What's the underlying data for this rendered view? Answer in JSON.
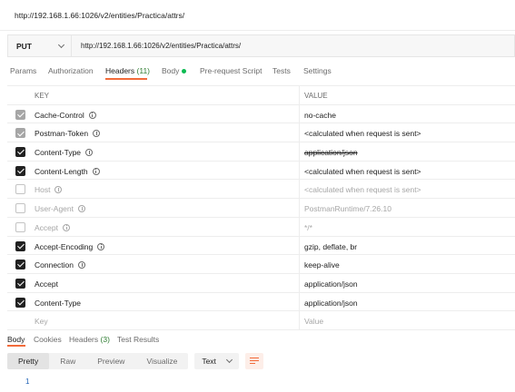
{
  "window": {
    "title_url": "http://192.168.1.66:1026/v2/entities/Practica/attrs/"
  },
  "request": {
    "method": "PUT",
    "url": "http://192.168.1.66:1026/v2/entities/Practica/attrs/"
  },
  "request_tabs": [
    {
      "label": "Params"
    },
    {
      "label": "Authorization"
    },
    {
      "label": "Headers",
      "count": "(11)"
    },
    {
      "label": "Body"
    },
    {
      "label": "Pre-request Script"
    },
    {
      "label": "Tests"
    },
    {
      "label": "Settings"
    }
  ],
  "headers_table": {
    "columns": {
      "key": "KEY",
      "value": "VALUE"
    },
    "rows": [
      {
        "key": "Cache-Control",
        "value": "no-cache",
        "state": "auto"
      },
      {
        "key": "Postman-Token",
        "value": "<calculated when request is sent>",
        "state": "auto"
      },
      {
        "key": "Content-Type",
        "value": "application/json",
        "state": "on",
        "overridden": true
      },
      {
        "key": "Content-Length",
        "value": "<calculated when request is sent>",
        "state": "on"
      },
      {
        "key": "Host",
        "value": "<calculated when request is sent>",
        "state": "off"
      },
      {
        "key": "User-Agent",
        "value": "PostmanRuntime/7.26.10",
        "state": "off"
      },
      {
        "key": "Accept",
        "value": "*/*",
        "state": "off"
      },
      {
        "key": "Accept-Encoding",
        "value": "gzip, deflate, br",
        "state": "on"
      },
      {
        "key": "Connection",
        "value": "keep-alive",
        "state": "on"
      },
      {
        "key": "Accept",
        "value": "application/json",
        "state": "on"
      },
      {
        "key": "Content-Type",
        "value": "application/json",
        "state": "on"
      }
    ],
    "placeholder": {
      "key": "Key",
      "value": "Value"
    }
  },
  "response_tabs": [
    {
      "label": "Body"
    },
    {
      "label": "Cookies"
    },
    {
      "label": "Headers",
      "count": "(3)"
    },
    {
      "label": "Test Results"
    }
  ],
  "view_modes": [
    "Pretty",
    "Raw",
    "Preview",
    "Visualize"
  ],
  "format": "Text",
  "line_number": "1",
  "colors": {
    "accent": "#f26b3a",
    "body_dot": "#0cbb52",
    "count": "#2f7d32"
  },
  "icons": {
    "info": "info-icon",
    "wrap": "wrap-lines-icon",
    "chevron": "chevron-down-icon"
  }
}
